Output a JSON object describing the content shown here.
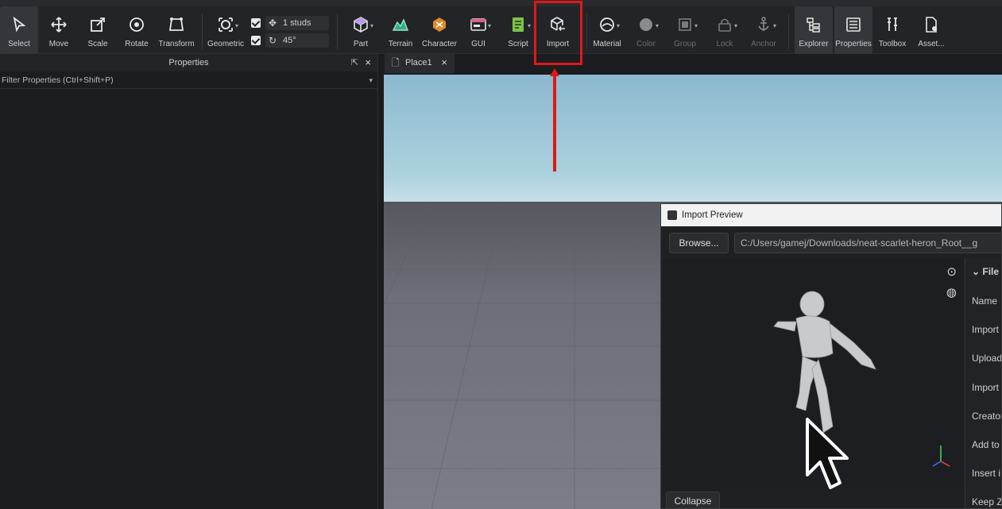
{
  "toolbar": {
    "items": [
      {
        "id": "select",
        "label": "Select",
        "icon": "cursor-icon"
      },
      {
        "id": "move",
        "label": "Move",
        "icon": "move-arrows-icon"
      },
      {
        "id": "scale",
        "label": "Scale",
        "icon": "scale-box-icon"
      },
      {
        "id": "rotate",
        "label": "Rotate",
        "icon": "rotate-icon"
      },
      {
        "id": "transform",
        "label": "Transform",
        "icon": "transform-icon"
      },
      {
        "id": "geometric",
        "label": "Geometric",
        "icon": "geometric-icon"
      },
      {
        "id": "part",
        "label": "Part",
        "icon": "cube-icon"
      },
      {
        "id": "terrain",
        "label": "Terrain",
        "icon": "terrain-icon"
      },
      {
        "id": "character",
        "label": "Character",
        "icon": "character-icon"
      },
      {
        "id": "gui",
        "label": "GUI",
        "icon": "gui-window-icon"
      },
      {
        "id": "script",
        "label": "Script",
        "icon": "script-icon"
      },
      {
        "id": "import",
        "label": "Import",
        "icon": "import-cube-icon"
      },
      {
        "id": "material",
        "label": "Material",
        "icon": "material-icon"
      },
      {
        "id": "color",
        "label": "Color",
        "icon": "color-circle-icon"
      },
      {
        "id": "group",
        "label": "Group",
        "icon": "group-icon"
      },
      {
        "id": "lock",
        "label": "Lock",
        "icon": "lock-icon"
      },
      {
        "id": "anchor",
        "label": "Anchor",
        "icon": "anchor-icon"
      },
      {
        "id": "explorer",
        "label": "Explorer",
        "icon": "explorer-tree-icon"
      },
      {
        "id": "properties",
        "label": "Properties",
        "icon": "properties-list-icon"
      },
      {
        "id": "toolbox",
        "label": "Toolbox",
        "icon": "toolbox-icon"
      },
      {
        "id": "asset",
        "label": "Asset...",
        "icon": "asset-manager-icon"
      }
    ],
    "snap_move": "1 studs",
    "snap_rotate": "45°"
  },
  "properties": {
    "title": "Properties",
    "filter_placeholder": "Filter Properties (Ctrl+Shift+P)"
  },
  "tabs": [
    {
      "label": "Place1"
    }
  ],
  "import_preview": {
    "title": "Import Preview",
    "browse_label": "Browse...",
    "path": "C:/Users/gamej/Downloads/neat-scarlet-heron_Root__g",
    "section": "File",
    "fields": [
      "Name",
      "Import",
      "Upload",
      "Import",
      "Creator",
      "Add to",
      "Insert i",
      "Keep Z"
    ],
    "collapse_label": "Collapse"
  },
  "colors": {
    "highlight": "#e01818",
    "sky": "#aed2df",
    "panel": "#1c1d20"
  }
}
